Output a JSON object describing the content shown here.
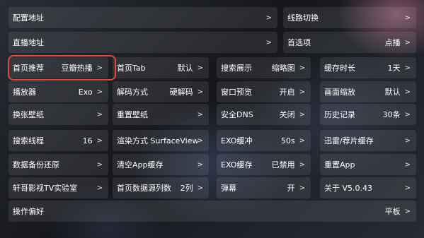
{
  "settings": {
    "row1": {
      "config_url": {
        "label": "配置地址",
        "chev": ">"
      },
      "line_switch": {
        "label": "线路切换",
        "chev": ">"
      }
    },
    "row2": {
      "live_url": {
        "label": "直播地址",
        "chev": ">"
      },
      "home_option": {
        "label": "首选项",
        "value": "点播",
        "chev": ">"
      }
    },
    "row3": [
      {
        "label": "首页推荐",
        "value": "豆瓣热播",
        "chev": ">"
      },
      {
        "label": "首页Tab",
        "value": "默认",
        "chev": ">"
      },
      {
        "label": "搜索展示",
        "value": "缩略图",
        "chev": ">"
      },
      {
        "label": "缓存时长",
        "value": "1天",
        "chev": ">"
      }
    ],
    "row4": [
      {
        "label": "播放器",
        "value": "Exo",
        "chev": ">"
      },
      {
        "label": "解码方式",
        "value": "硬解码",
        "chev": ">"
      },
      {
        "label": "窗口预览",
        "value": "开启",
        "chev": ">"
      },
      {
        "label": "画面缩放",
        "value": "默认",
        "chev": ">"
      }
    ],
    "row5": [
      {
        "label": "换张壁纸",
        "value": "",
        "chev": ">"
      },
      {
        "label": "重置壁纸",
        "value": "",
        "chev": ">"
      },
      {
        "label": "安全DNS",
        "value": "关闭",
        "chev": ">"
      },
      {
        "label": "历史记录",
        "value": "30条",
        "chev": ">"
      }
    ],
    "row6": [
      {
        "label": "搜索线程",
        "value": "16",
        "chev": ">"
      },
      {
        "label": "渲染方式 SurfaceView",
        "value": "",
        "chev": ">"
      },
      {
        "label": "EXO缓冲",
        "value": "50s",
        "chev": ">"
      },
      {
        "label": "迅雷/荐片缓存",
        "value": "",
        "chev": ">"
      }
    ],
    "row7": [
      {
        "label": "数据备份还原",
        "value": "",
        "chev": ">"
      },
      {
        "label": "清空App缓存",
        "value": "",
        "chev": ">"
      },
      {
        "label": "EXO缓存",
        "value": "已禁用",
        "chev": ">"
      },
      {
        "label": "重置App",
        "value": "",
        "chev": ">"
      }
    ],
    "row8": [
      {
        "label": "轩哥影视TV实验室",
        "value": "",
        "chev": ">"
      },
      {
        "label": "首页数据源列数",
        "value": "2列",
        "chev": ">"
      },
      {
        "label": "弹幕",
        "value": "开",
        "chev": ">"
      },
      {
        "label": "关于  V5.0.43",
        "value": "",
        "chev": ">"
      }
    ],
    "row9": {
      "operation_pref": {
        "label": "操作偏好",
        "value": "平板",
        "chev": ">"
      }
    }
  }
}
